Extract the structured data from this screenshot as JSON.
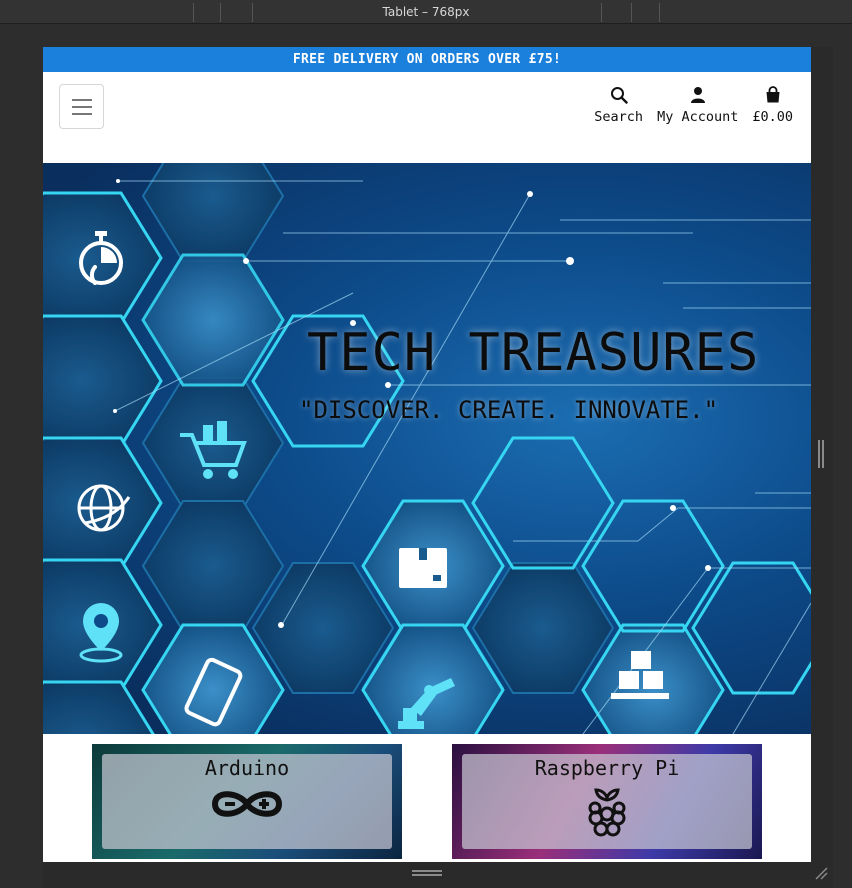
{
  "devtools": {
    "title": "Tablet – 768px"
  },
  "promo": {
    "text": "FREE DELIVERY ON ORDERS OVER £75!"
  },
  "header": {
    "nav": [
      {
        "label": "Search",
        "icon": "search-icon"
      },
      {
        "label": "My Account",
        "icon": "user-icon"
      },
      {
        "label": "£0.00",
        "icon": "shopping-bag-icon"
      }
    ]
  },
  "hero": {
    "title": "TECH TREASURES",
    "tagline": "\"DISCOVER. CREATE. INNOVATE.\""
  },
  "categories": [
    {
      "label": "Arduino",
      "icon": "arduino-logo"
    },
    {
      "label": "Raspberry Pi",
      "icon": "raspberry-pi-logo"
    }
  ],
  "colors": {
    "promo_bg": "#1b7fdc",
    "hex_glow": "#36d6f2"
  }
}
